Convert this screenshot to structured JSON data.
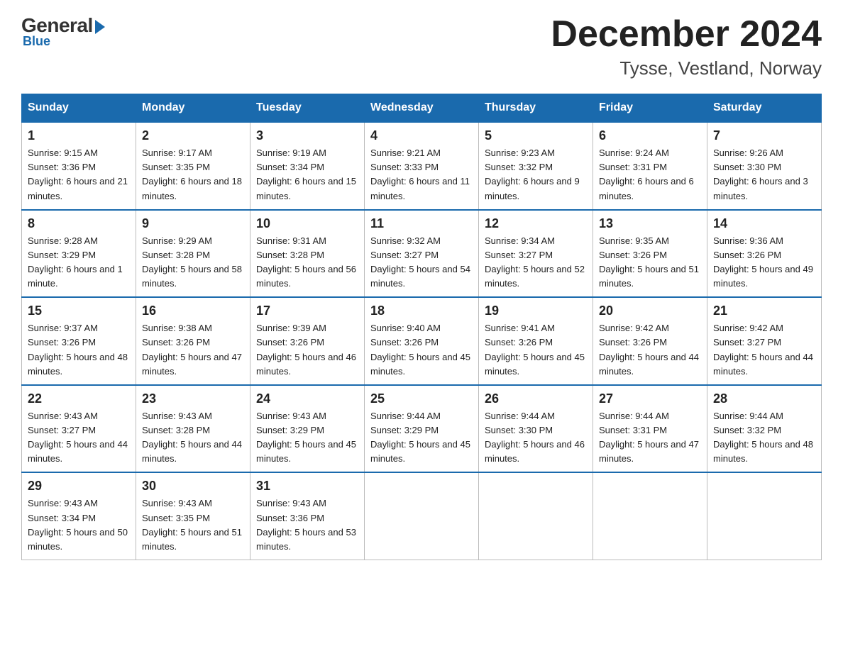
{
  "logo": {
    "general": "General",
    "blue": "Blue"
  },
  "header": {
    "month_year": "December 2024",
    "location": "Tysse, Vestland, Norway"
  },
  "weekdays": [
    "Sunday",
    "Monday",
    "Tuesday",
    "Wednesday",
    "Thursday",
    "Friday",
    "Saturday"
  ],
  "weeks": [
    [
      {
        "day": "1",
        "sunrise": "9:15 AM",
        "sunset": "3:36 PM",
        "daylight": "6 hours and 21 minutes."
      },
      {
        "day": "2",
        "sunrise": "9:17 AM",
        "sunset": "3:35 PM",
        "daylight": "6 hours and 18 minutes."
      },
      {
        "day": "3",
        "sunrise": "9:19 AM",
        "sunset": "3:34 PM",
        "daylight": "6 hours and 15 minutes."
      },
      {
        "day": "4",
        "sunrise": "9:21 AM",
        "sunset": "3:33 PM",
        "daylight": "6 hours and 11 minutes."
      },
      {
        "day": "5",
        "sunrise": "9:23 AM",
        "sunset": "3:32 PM",
        "daylight": "6 hours and 9 minutes."
      },
      {
        "day": "6",
        "sunrise": "9:24 AM",
        "sunset": "3:31 PM",
        "daylight": "6 hours and 6 minutes."
      },
      {
        "day": "7",
        "sunrise": "9:26 AM",
        "sunset": "3:30 PM",
        "daylight": "6 hours and 3 minutes."
      }
    ],
    [
      {
        "day": "8",
        "sunrise": "9:28 AM",
        "sunset": "3:29 PM",
        "daylight": "6 hours and 1 minute."
      },
      {
        "day": "9",
        "sunrise": "9:29 AM",
        "sunset": "3:28 PM",
        "daylight": "5 hours and 58 minutes."
      },
      {
        "day": "10",
        "sunrise": "9:31 AM",
        "sunset": "3:28 PM",
        "daylight": "5 hours and 56 minutes."
      },
      {
        "day": "11",
        "sunrise": "9:32 AM",
        "sunset": "3:27 PM",
        "daylight": "5 hours and 54 minutes."
      },
      {
        "day": "12",
        "sunrise": "9:34 AM",
        "sunset": "3:27 PM",
        "daylight": "5 hours and 52 minutes."
      },
      {
        "day": "13",
        "sunrise": "9:35 AM",
        "sunset": "3:26 PM",
        "daylight": "5 hours and 51 minutes."
      },
      {
        "day": "14",
        "sunrise": "9:36 AM",
        "sunset": "3:26 PM",
        "daylight": "5 hours and 49 minutes."
      }
    ],
    [
      {
        "day": "15",
        "sunrise": "9:37 AM",
        "sunset": "3:26 PM",
        "daylight": "5 hours and 48 minutes."
      },
      {
        "day": "16",
        "sunrise": "9:38 AM",
        "sunset": "3:26 PM",
        "daylight": "5 hours and 47 minutes."
      },
      {
        "day": "17",
        "sunrise": "9:39 AM",
        "sunset": "3:26 PM",
        "daylight": "5 hours and 46 minutes."
      },
      {
        "day": "18",
        "sunrise": "9:40 AM",
        "sunset": "3:26 PM",
        "daylight": "5 hours and 45 minutes."
      },
      {
        "day": "19",
        "sunrise": "9:41 AM",
        "sunset": "3:26 PM",
        "daylight": "5 hours and 45 minutes."
      },
      {
        "day": "20",
        "sunrise": "9:42 AM",
        "sunset": "3:26 PM",
        "daylight": "5 hours and 44 minutes."
      },
      {
        "day": "21",
        "sunrise": "9:42 AM",
        "sunset": "3:27 PM",
        "daylight": "5 hours and 44 minutes."
      }
    ],
    [
      {
        "day": "22",
        "sunrise": "9:43 AM",
        "sunset": "3:27 PM",
        "daylight": "5 hours and 44 minutes."
      },
      {
        "day": "23",
        "sunrise": "9:43 AM",
        "sunset": "3:28 PM",
        "daylight": "5 hours and 44 minutes."
      },
      {
        "day": "24",
        "sunrise": "9:43 AM",
        "sunset": "3:29 PM",
        "daylight": "5 hours and 45 minutes."
      },
      {
        "day": "25",
        "sunrise": "9:44 AM",
        "sunset": "3:29 PM",
        "daylight": "5 hours and 45 minutes."
      },
      {
        "day": "26",
        "sunrise": "9:44 AM",
        "sunset": "3:30 PM",
        "daylight": "5 hours and 46 minutes."
      },
      {
        "day": "27",
        "sunrise": "9:44 AM",
        "sunset": "3:31 PM",
        "daylight": "5 hours and 47 minutes."
      },
      {
        "day": "28",
        "sunrise": "9:44 AM",
        "sunset": "3:32 PM",
        "daylight": "5 hours and 48 minutes."
      }
    ],
    [
      {
        "day": "29",
        "sunrise": "9:43 AM",
        "sunset": "3:34 PM",
        "daylight": "5 hours and 50 minutes."
      },
      {
        "day": "30",
        "sunrise": "9:43 AM",
        "sunset": "3:35 PM",
        "daylight": "5 hours and 51 minutes."
      },
      {
        "day": "31",
        "sunrise": "9:43 AM",
        "sunset": "3:36 PM",
        "daylight": "5 hours and 53 minutes."
      },
      null,
      null,
      null,
      null
    ]
  ]
}
